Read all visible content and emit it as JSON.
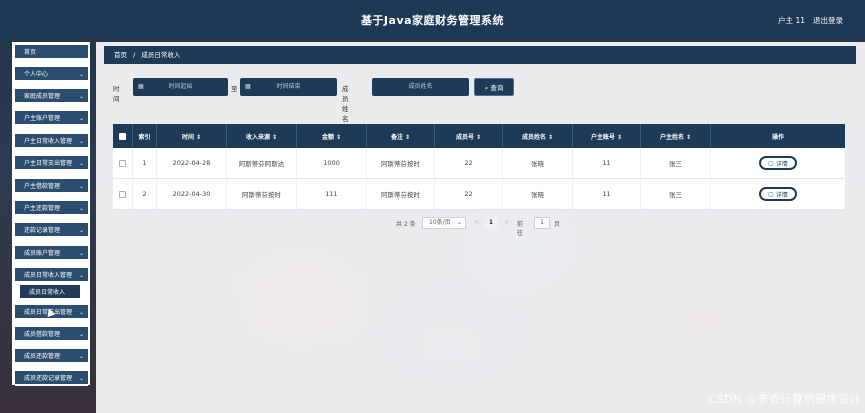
{
  "header": {
    "title": "基于Java家庭财务管理系统",
    "user": "户主 11",
    "logout": "退出登录"
  },
  "sidebar": {
    "items": [
      {
        "label": "首页",
        "chevron": false
      },
      {
        "label": "个人中心",
        "chevron": true
      },
      {
        "label": "家庭成员管理",
        "chevron": true
      },
      {
        "label": "户主账户管理",
        "chevron": true
      },
      {
        "label": "户主日常收入管理",
        "chevron": true
      },
      {
        "label": "户主日常支出管理",
        "chevron": true
      },
      {
        "label": "户主借款管理",
        "chevron": true
      },
      {
        "label": "户主还款管理",
        "chevron": true
      },
      {
        "label": "还款记录管理",
        "chevron": true
      },
      {
        "label": "成员账户管理",
        "chevron": true
      },
      {
        "label": "成员日常收入管理",
        "chevron": true
      },
      {
        "label": "成员日常收入",
        "chevron": false,
        "sub": true
      },
      {
        "label": "成员日常支出管理",
        "chevron": true
      },
      {
        "label": "成员借款管理",
        "chevron": true
      },
      {
        "label": "成员还款管理",
        "chevron": true
      },
      {
        "label": "成员还款记录管理",
        "chevron": true
      }
    ],
    "chevron_glyph": "⌄"
  },
  "breadcrumb": {
    "home": "首页",
    "separator": "/",
    "current": "成员日常收入"
  },
  "search": {
    "time_label": "时间",
    "start_placeholder": "时间起始",
    "to_label": "至",
    "end_placeholder": "时间结束",
    "name_label": "成员姓名",
    "name_placeholder": "成员姓名",
    "button_label": "查询",
    "calendar_icon": "calendar-icon",
    "search_icon": "search-icon"
  },
  "table": {
    "headers": [
      "",
      "索引",
      "时间 ⇕",
      "收入来源 ⇕",
      "金额 ⇕",
      "备注 ⇕",
      "成员号 ⇕",
      "成员姓名 ⇕",
      "户主账号 ⇕",
      "户主姓名 ⇕",
      "操作"
    ],
    "rows": [
      {
        "index": "1",
        "time": "2022-04-28",
        "source": "阿斯蒂芬阿斯达",
        "amount": "1000",
        "note": "阿斯蒂芬按时",
        "member_no": "22",
        "member_name": "张晓",
        "owner_account": "11",
        "owner_name": "张三",
        "action": "详情"
      },
      {
        "index": "2",
        "time": "2022-04-30",
        "source": "阿斯蒂芬按时",
        "amount": "111",
        "note": "阿斯蒂芬按时",
        "member_no": "22",
        "member_name": "张晓",
        "owner_account": "11",
        "owner_name": "张三",
        "action": "详情"
      }
    ]
  },
  "pagination": {
    "total": "共 2 条",
    "page_size": "10条/页",
    "prev": "<",
    "current_page": "1",
    "next": ">",
    "goto_label": "前往",
    "goto_value": "1",
    "page_suffix": "页"
  },
  "watermark": "CSDN @李会计算机程序设计",
  "colors": {
    "primary": "#1e3a56",
    "menu": "#2b4d70",
    "header": "#1d3956"
  }
}
